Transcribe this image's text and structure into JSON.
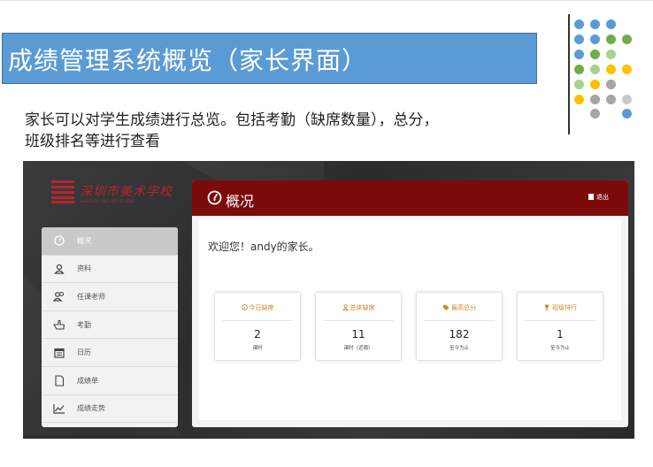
{
  "slide": {
    "title": "成绩管理系统概览（家长界面）",
    "description_line1": "家长可以对学生成绩进行总览。包括考勤（缺席数量），总分，",
    "description_line2": "班级排名等进行查看"
  },
  "decoration": {
    "dot_colors": [
      "#5b9bd5",
      "#70ad47",
      "#a9d18e",
      "#ffc000",
      "#a5a5a5",
      "#c9c9c9"
    ]
  },
  "app": {
    "logo_text": "深圳市美术学校",
    "logo_sub": "SHENZHEN FINE ARTS SCHOOL",
    "sidebar": {
      "items": [
        {
          "label": "概况",
          "icon": "dashboard-icon"
        },
        {
          "label": "资料",
          "icon": "user-icon"
        },
        {
          "label": "任课老师",
          "icon": "users-icon"
        },
        {
          "label": "考勤",
          "icon": "hand-pointer-icon"
        },
        {
          "label": "日历",
          "icon": "calendar-icon"
        },
        {
          "label": "成绩单",
          "icon": "document-icon"
        },
        {
          "label": "成绩走势",
          "icon": "line-chart-icon"
        }
      ]
    },
    "panel": {
      "title": "概况",
      "logout_label": "退出",
      "welcome": "欢迎您！andy的家长。",
      "cards": [
        {
          "label": "今日缺席",
          "value": "2",
          "unit": "课时",
          "icon": "info-icon"
        },
        {
          "label": "总体缺席",
          "value": "11",
          "unit": "课时（近周）",
          "icon": "user-icon"
        },
        {
          "label": "最高总分",
          "value": "182",
          "unit": "至今为止",
          "icon": "tag-icon"
        },
        {
          "label": "班级排行",
          "value": "1",
          "unit": "至今为止",
          "icon": "trophy-icon"
        }
      ]
    }
  }
}
